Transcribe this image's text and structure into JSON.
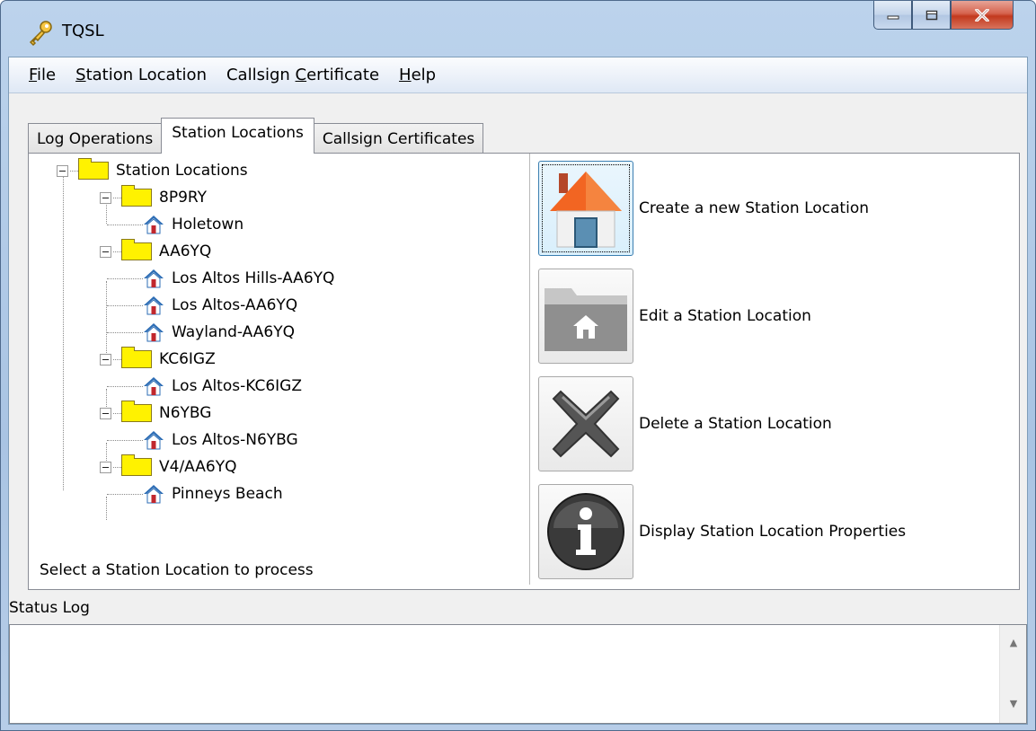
{
  "window": {
    "title": "TQSL"
  },
  "menu": [
    {
      "pre": "",
      "key": "F",
      "post": "ile"
    },
    {
      "pre": "",
      "key": "S",
      "post": "tation Location"
    },
    {
      "pre": "Callsign ",
      "key": "C",
      "post": "ertificate"
    },
    {
      "pre": "",
      "key": "H",
      "post": "elp"
    }
  ],
  "tabs": {
    "log_operations": "Log Operations",
    "station_locations": "Station Locations",
    "callsign_certificates": "Callsign Certificates"
  },
  "tree": {
    "root": "Station Locations",
    "groups": [
      {
        "callsign": "8P9RY",
        "locations": [
          "Holetown"
        ]
      },
      {
        "callsign": "AA6YQ",
        "locations": [
          "Los Altos Hills-AA6YQ",
          "Los Altos-AA6YQ",
          "Wayland-AA6YQ"
        ]
      },
      {
        "callsign": "KC6IGZ",
        "locations": [
          "Los Altos-KC6IGZ"
        ]
      },
      {
        "callsign": "N6YBG",
        "locations": [
          "Los Altos-N6YBG"
        ]
      },
      {
        "callsign": "V4/AA6YQ",
        "locations": [
          "Pinneys Beach"
        ]
      }
    ]
  },
  "prompt": "Select a Station Location to process",
  "actions": {
    "create": "Create a new Station Location",
    "edit": "Edit a Station Location",
    "delete": "Delete a Station Location",
    "properties": "Display Station Location Properties"
  },
  "status_log": {
    "label": "Status Log",
    "content": ""
  },
  "colors": {
    "folder": "#fff200",
    "house_roof": "#f26522",
    "title_bar": "#b7cde8"
  }
}
